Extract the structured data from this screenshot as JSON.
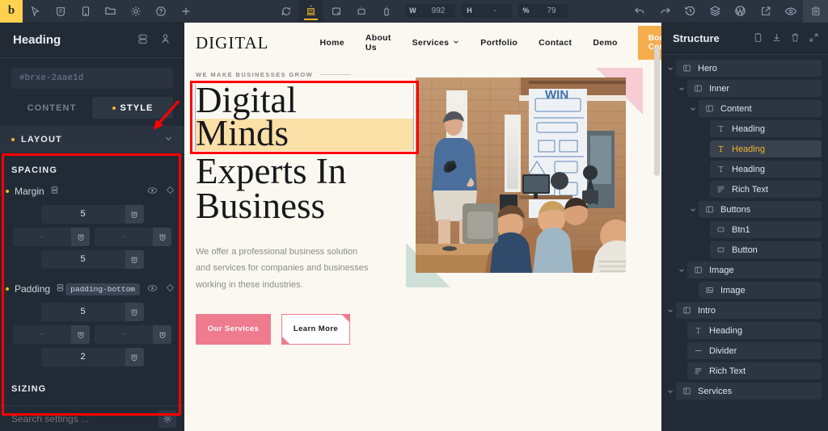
{
  "toolbar": {
    "logo": "b",
    "tools": [
      {
        "name": "cursor-icon",
        "title": "Select"
      },
      {
        "name": "bricks-badge-icon",
        "title": "Bricks"
      },
      {
        "name": "mobile-portrait-icon",
        "title": "Device"
      },
      {
        "name": "folder-icon",
        "title": "Templates"
      },
      {
        "name": "gear-icon",
        "title": "Settings"
      },
      {
        "name": "help-icon",
        "title": "Help"
      },
      {
        "name": "plus-icon",
        "title": "Add element"
      }
    ],
    "responsive": [
      {
        "name": "refresh-icon",
        "active": false
      },
      {
        "name": "desktop-icon",
        "active": true
      },
      {
        "name": "laptop-icon",
        "active": false
      },
      {
        "name": "tablet-icon",
        "active": false
      },
      {
        "name": "mobile-icon",
        "active": false
      }
    ],
    "width_label": "W",
    "width_value": "992",
    "height_label": "H",
    "height_value": "-",
    "zoom_label": "%",
    "zoom_value": "79",
    "right_tools": [
      {
        "name": "undo-icon"
      },
      {
        "name": "redo-icon"
      },
      {
        "name": "revisions-icon"
      },
      {
        "name": "layers-icon"
      },
      {
        "name": "wordpress-icon"
      },
      {
        "name": "external-link-icon"
      },
      {
        "name": "preview-eye-icon"
      },
      {
        "name": "save-icon"
      }
    ]
  },
  "left_panel": {
    "title": "Heading",
    "header_icons": [
      "duplicate-icon",
      "user-icon"
    ],
    "element_id": "#brxe-2aae1d",
    "tabs": [
      {
        "label": "CONTENT",
        "active": false,
        "dot": false
      },
      {
        "label": "STYLE",
        "active": true,
        "dot": true
      }
    ],
    "accordion": {
      "label": "LAYOUT",
      "expanded": true
    },
    "spacing": {
      "section_label": "SPACING",
      "margin": {
        "label": "Margin",
        "top": "5",
        "left": "-",
        "right": "-",
        "bottom": "5"
      },
      "padding": {
        "label": "Padding",
        "tooltip": "padding-bottom",
        "top": "5",
        "left": "-",
        "right": "-",
        "bottom": "2"
      }
    },
    "sizing_label": "SIZING",
    "search_placeholder": "Search settings ...",
    "search_value": ""
  },
  "canvas": {
    "brand": "DIGITAL",
    "nav": [
      {
        "label": "Home",
        "dropdown": false
      },
      {
        "label": "About Us",
        "dropdown": false
      },
      {
        "label": "Services",
        "dropdown": true
      },
      {
        "label": "Portfolio",
        "dropdown": false
      },
      {
        "label": "Contact",
        "dropdown": false
      },
      {
        "label": "Demo",
        "dropdown": false
      }
    ],
    "cta_label": "Book Consultation",
    "cta_color": "#f6ad4e",
    "hero": {
      "eyebrow": "WE MAKE BUSINESSES GROW",
      "heading_selected_line1": "Digital",
      "heading_selected_line2": "Minds",
      "heading_second_line1": "Experts In",
      "heading_second_line2": "Business",
      "paragraph": "We offer a professional business solution and services for companies and businesses working in these industries.",
      "buttons": [
        {
          "label": "Our Services",
          "style": "solid",
          "color": "#ef7b8e"
        },
        {
          "label": "Learn More",
          "style": "outline",
          "color": "#ef7b8e"
        }
      ],
      "image_alt": "Man presenting to seated audience in brick office",
      "highlight_color": "#fadfa6",
      "selection_color": "#ff0000"
    }
  },
  "right_panel": {
    "title": "Structure",
    "header_icons": [
      "clipboard-icon",
      "download-icon",
      "trash-icon",
      "collapse-icon"
    ],
    "tree": [
      {
        "label": "Hero",
        "icon": "container-icon",
        "depth": 0,
        "caret": true,
        "selected": false
      },
      {
        "label": "Inner",
        "icon": "container-icon",
        "depth": 1,
        "caret": true,
        "selected": false
      },
      {
        "label": "Content",
        "icon": "container-icon",
        "depth": 2,
        "caret": true,
        "selected": false
      },
      {
        "label": "Heading",
        "icon": "text-icon",
        "depth": 3,
        "caret": false,
        "selected": false
      },
      {
        "label": "Heading",
        "icon": "text-icon",
        "depth": 3,
        "caret": false,
        "selected": true
      },
      {
        "label": "Heading",
        "icon": "text-icon",
        "depth": 3,
        "caret": false,
        "selected": false
      },
      {
        "label": "Rich Text",
        "icon": "richtext-icon",
        "depth": 3,
        "caret": false,
        "selected": false
      },
      {
        "label": "Buttons",
        "icon": "container-icon",
        "depth": 2,
        "caret": true,
        "selected": false
      },
      {
        "label": "Btn1",
        "icon": "button-icon",
        "depth": 3,
        "caret": false,
        "selected": false
      },
      {
        "label": "Button",
        "icon": "button-icon",
        "depth": 3,
        "caret": false,
        "selected": false
      },
      {
        "label": "Image",
        "icon": "container-icon",
        "depth": 1,
        "caret": true,
        "selected": false
      },
      {
        "label": "Image",
        "icon": "image-icon",
        "depth": 2,
        "caret": false,
        "selected": false
      },
      {
        "label": "Intro",
        "icon": "container-icon",
        "depth": 0,
        "caret": true,
        "selected": false
      },
      {
        "label": "Heading",
        "icon": "text-icon",
        "depth": 1,
        "caret": false,
        "selected": false
      },
      {
        "label": "Divider",
        "icon": "divider-icon",
        "depth": 1,
        "caret": false,
        "selected": false
      },
      {
        "label": "Rich Text",
        "icon": "richtext-icon",
        "depth": 1,
        "caret": false,
        "selected": false
      },
      {
        "label": "Services",
        "icon": "container-icon",
        "depth": 0,
        "caret": true,
        "selected": false
      }
    ]
  }
}
